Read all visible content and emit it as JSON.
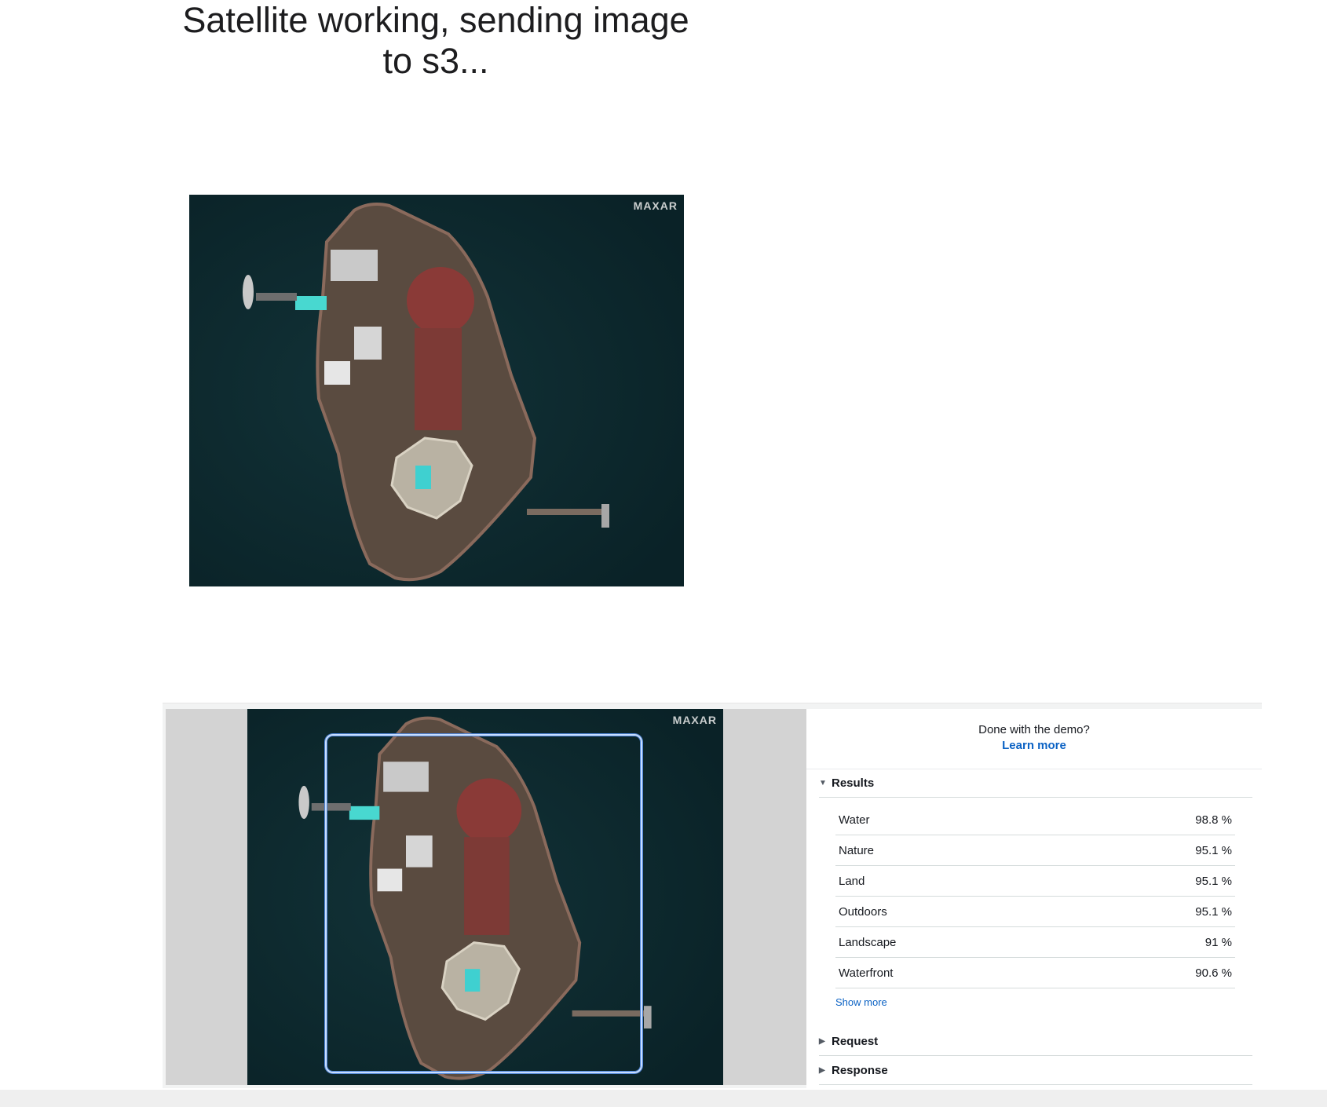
{
  "page": {
    "title": "Satellite working, sending image to s3..."
  },
  "top_image": {
    "watermark": "MAXAR"
  },
  "viewer": {
    "watermark": "MAXAR"
  },
  "demo_panel": {
    "done_text": "Done with the demo?",
    "learn_more": "Learn more"
  },
  "results": {
    "header": "Results",
    "labels": [
      {
        "name": "Water",
        "confidence": "98.8 %"
      },
      {
        "name": "Nature",
        "confidence": "95.1 %"
      },
      {
        "name": "Land",
        "confidence": "95.1 %"
      },
      {
        "name": "Outdoors",
        "confidence": "95.1 %"
      },
      {
        "name": "Landscape",
        "confidence": "91 %"
      },
      {
        "name": "Waterfront",
        "confidence": "90.6 %"
      }
    ],
    "show_more": "Show more"
  },
  "request": {
    "header": "Request"
  },
  "response": {
    "header": "Response"
  },
  "icons": {
    "expanded": "caret-down-icon",
    "collapsed": "caret-right-icon"
  },
  "colors": {
    "link": "#0b62c4",
    "bounding_box": "#4f86d9",
    "water": "#0e2a30"
  }
}
